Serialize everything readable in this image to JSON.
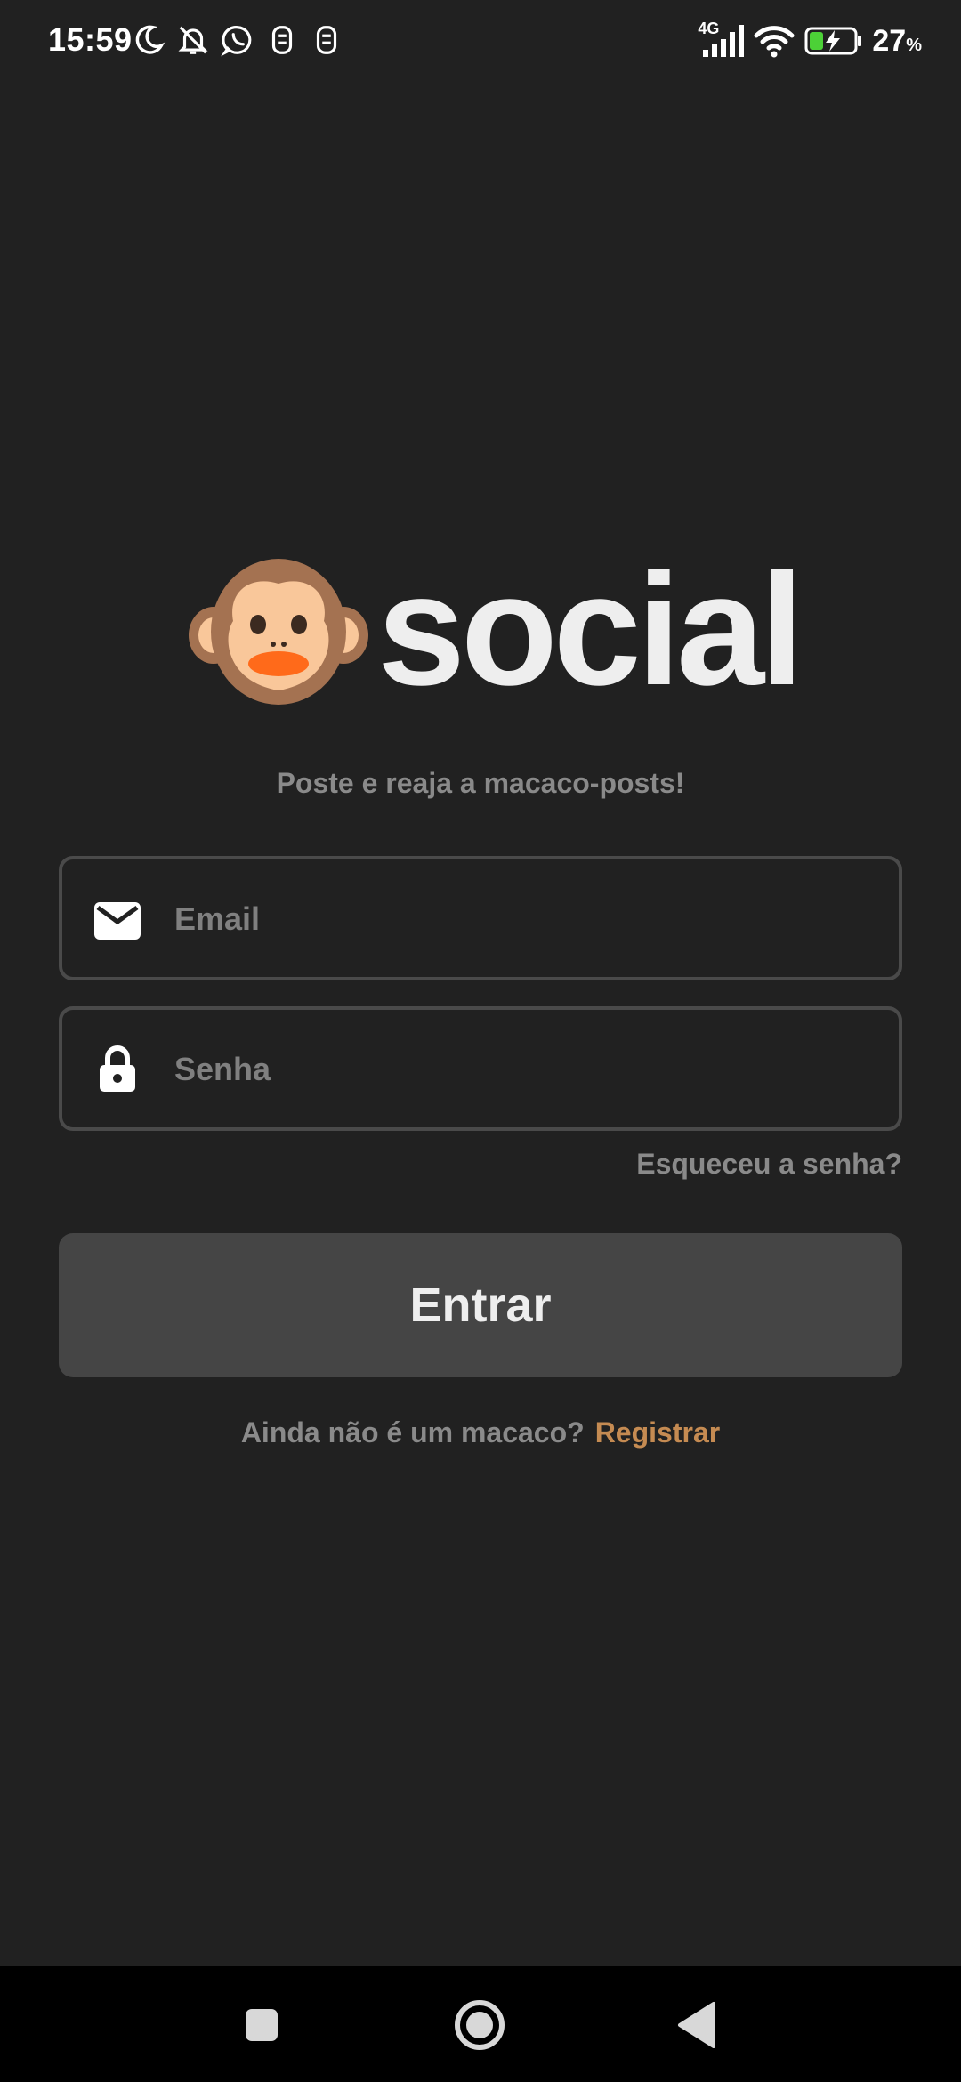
{
  "status_bar": {
    "time": "15:59",
    "left_icons": [
      "moon-icon",
      "bell-off-icon",
      "whatsapp-icon",
      "app-icon",
      "app-icon"
    ],
    "network_type": "4G",
    "battery_percent": "27",
    "battery_unit": "%"
  },
  "logo": {
    "emoji": "monkey-face-icon",
    "word": "social"
  },
  "tagline": "Poste e reaja a macaco-posts!",
  "email_field": {
    "placeholder": "Email",
    "value": "",
    "icon": "mail-icon"
  },
  "password_field": {
    "placeholder": "Senha",
    "value": "",
    "icon": "lock-icon"
  },
  "forgot_password": "Esqueceu a senha?",
  "login_button": "Entrar",
  "register": {
    "prompt": "Ainda não é um macaco?",
    "link": "Registrar"
  },
  "colors": {
    "background": "#212121",
    "field_border": "#4a4a4a",
    "button_bg": "#454545",
    "muted_text": "#8a8a8a",
    "accent": "#c58b52",
    "battery_green": "#4cd137"
  },
  "nav_bar": {
    "buttons": [
      "recent-apps-icon",
      "home-icon",
      "back-icon"
    ]
  }
}
